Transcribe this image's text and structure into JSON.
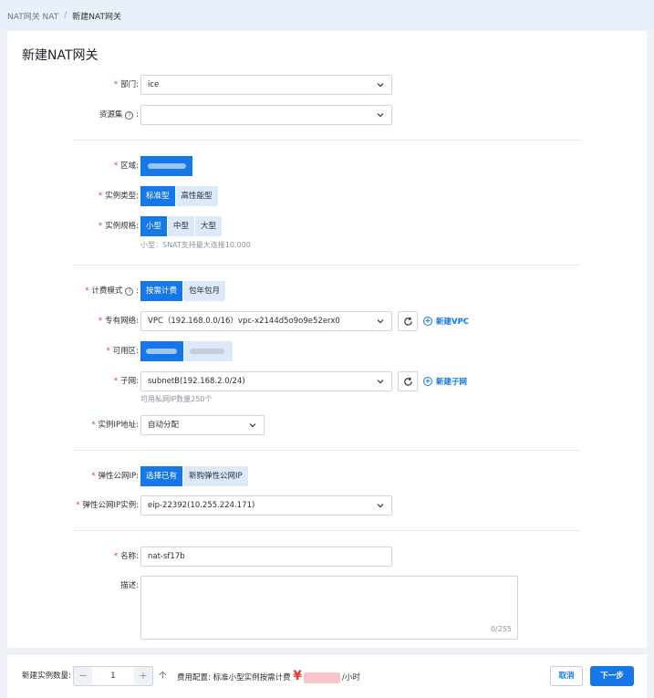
{
  "breadcrumb": {
    "parent": "NAT网关 NAT",
    "separator": "/",
    "current": "新建NAT网关"
  },
  "page_title": "新建NAT网关",
  "form": {
    "department": {
      "label": "部门:",
      "value": "ice"
    },
    "resource_set": {
      "label": "资源集",
      "help": "?",
      "value": ""
    },
    "region": {
      "label": "区域:"
    },
    "instance_type": {
      "label": "实例类型:",
      "options": [
        "标准型",
        "高性能型"
      ],
      "selected": "标准型"
    },
    "instance_spec": {
      "label": "实例规格:",
      "options": [
        "小型",
        "中型",
        "大型"
      ],
      "selected": "小型",
      "hint": "小型：SNAT支持最大连接10,000"
    },
    "billing_mode": {
      "label": "计费模式",
      "help": "?",
      "options": [
        "按需计费",
        "包年包月"
      ],
      "selected": "按需计费"
    },
    "vpc": {
      "label": "专有网络:",
      "value": "VPC（192.168.0.0/16）vpc-x2144d5o9o9e52erx0",
      "create_link": "新建VPC"
    },
    "zone": {
      "label": "可用区:"
    },
    "subnet": {
      "label": "子网:",
      "value": "subnetB(192.168.2.0/24)",
      "create_link": "新建子网",
      "hint": "可用私网IP数量250个"
    },
    "instance_ip": {
      "label": "实例IP地址:",
      "value": "自动分配"
    },
    "eip": {
      "label": "弹性公网IP:",
      "options": [
        "选择已有",
        "新购弹性公网IP"
      ],
      "selected": "选择已有"
    },
    "eip_instance": {
      "label": "弹性公网IP实例:",
      "value": "eip-22392(10.255.224.171)"
    },
    "name": {
      "label": "名称:",
      "value": "nat-sf17b"
    },
    "description": {
      "label": "描述:",
      "value": "",
      "counter": "0/255"
    }
  },
  "footer": {
    "quantity_label": "新建实例数量:",
    "minus": "−",
    "quantity": "1",
    "plus": "+",
    "unit": "个",
    "fee_label": "费用配置: 标准小型实例按需计费",
    "currency": "¥",
    "per_hour": "/小时",
    "cancel": "取消",
    "next": "下一步"
  },
  "colors": {
    "primary": "#1677e8",
    "required": "#e03a3a",
    "option_bg": "#dce9f8"
  }
}
